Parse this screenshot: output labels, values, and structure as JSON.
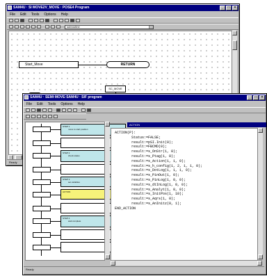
{
  "back_window": {
    "title": "SAM4U · SI MOVE2V_MOVE · POSE4 Program",
    "menu": [
      "File",
      "Edit",
      "Tools",
      "Options",
      "Help"
    ],
    "combo_value": "subroutine",
    "start_step_label": "Start_Move",
    "return_label": "RETURN",
    "small_box_label": "SC_MOVE",
    "status_text": "Ready"
  },
  "front_window": {
    "title": "SAM4U · SEMI·MOVE·SAM4U · SIF program",
    "menu": [
      "File",
      "Edit",
      "Tools",
      "Options",
      "Help"
    ],
    "left_cells": [
      {
        "label": "STEP 1",
        "desc": "move to start position",
        "color": "cyan"
      },
      {
        "label": "",
        "desc": "",
        "color": "white"
      },
      {
        "label": "STEP 2",
        "desc": "check status",
        "color": "cyan"
      },
      {
        "label": "",
        "desc": "",
        "color": "white"
      },
      {
        "label": "STEP 3",
        "desc": "set variables",
        "color": "cyan"
      },
      {
        "label": "ACTION",
        "desc": "",
        "color": "yellow"
      },
      {
        "label": "",
        "desc": "",
        "color": "white"
      },
      {
        "label": "STEP 4",
        "desc": "wait complete",
        "color": "cyan"
      },
      {
        "label": "",
        "desc": "",
        "color": "white"
      },
      {
        "label": "",
        "desc": "",
        "color": "white"
      }
    ],
    "code_header": "ACTION",
    "code_lines": [
      "ACTION(P):",
      "        Status:=FALSE;",
      "        result:=pSI.Init(0);",
      "        result:=FBCMD(0);",
      "        result:=s_OnStr(1, 0);",
      "        result:=s_Ptag(1, 0);",
      "        result:=s_Action(1, 1, 0);",
      "        result:=s_h_config(1, 2, 1, 1, 0);",
      "        result:=s_DotLog(1, 1, 1, 0);",
      "        result:=s_PinOut(1, 0);",
      "        result:=s_PinLog(1, 0, 0);",
      "        result:=s_dtInLog(1, 0, 0);",
      "        result:=s_Analyt(1, 0, 0);",
      "        result:=s_InitPos(1, 10);",
      "        result:=s_Aqrs(1, 0);",
      "        result:=s_AnInitz(0, 1);",
      "END_ACTION"
    ],
    "status_text": "Ready"
  },
  "colors": {
    "title_bar": "#000080",
    "cyan_cell": "#bfe6ea",
    "yellow_cell": "#f6f27a",
    "chrome": "#c0c0c0"
  }
}
